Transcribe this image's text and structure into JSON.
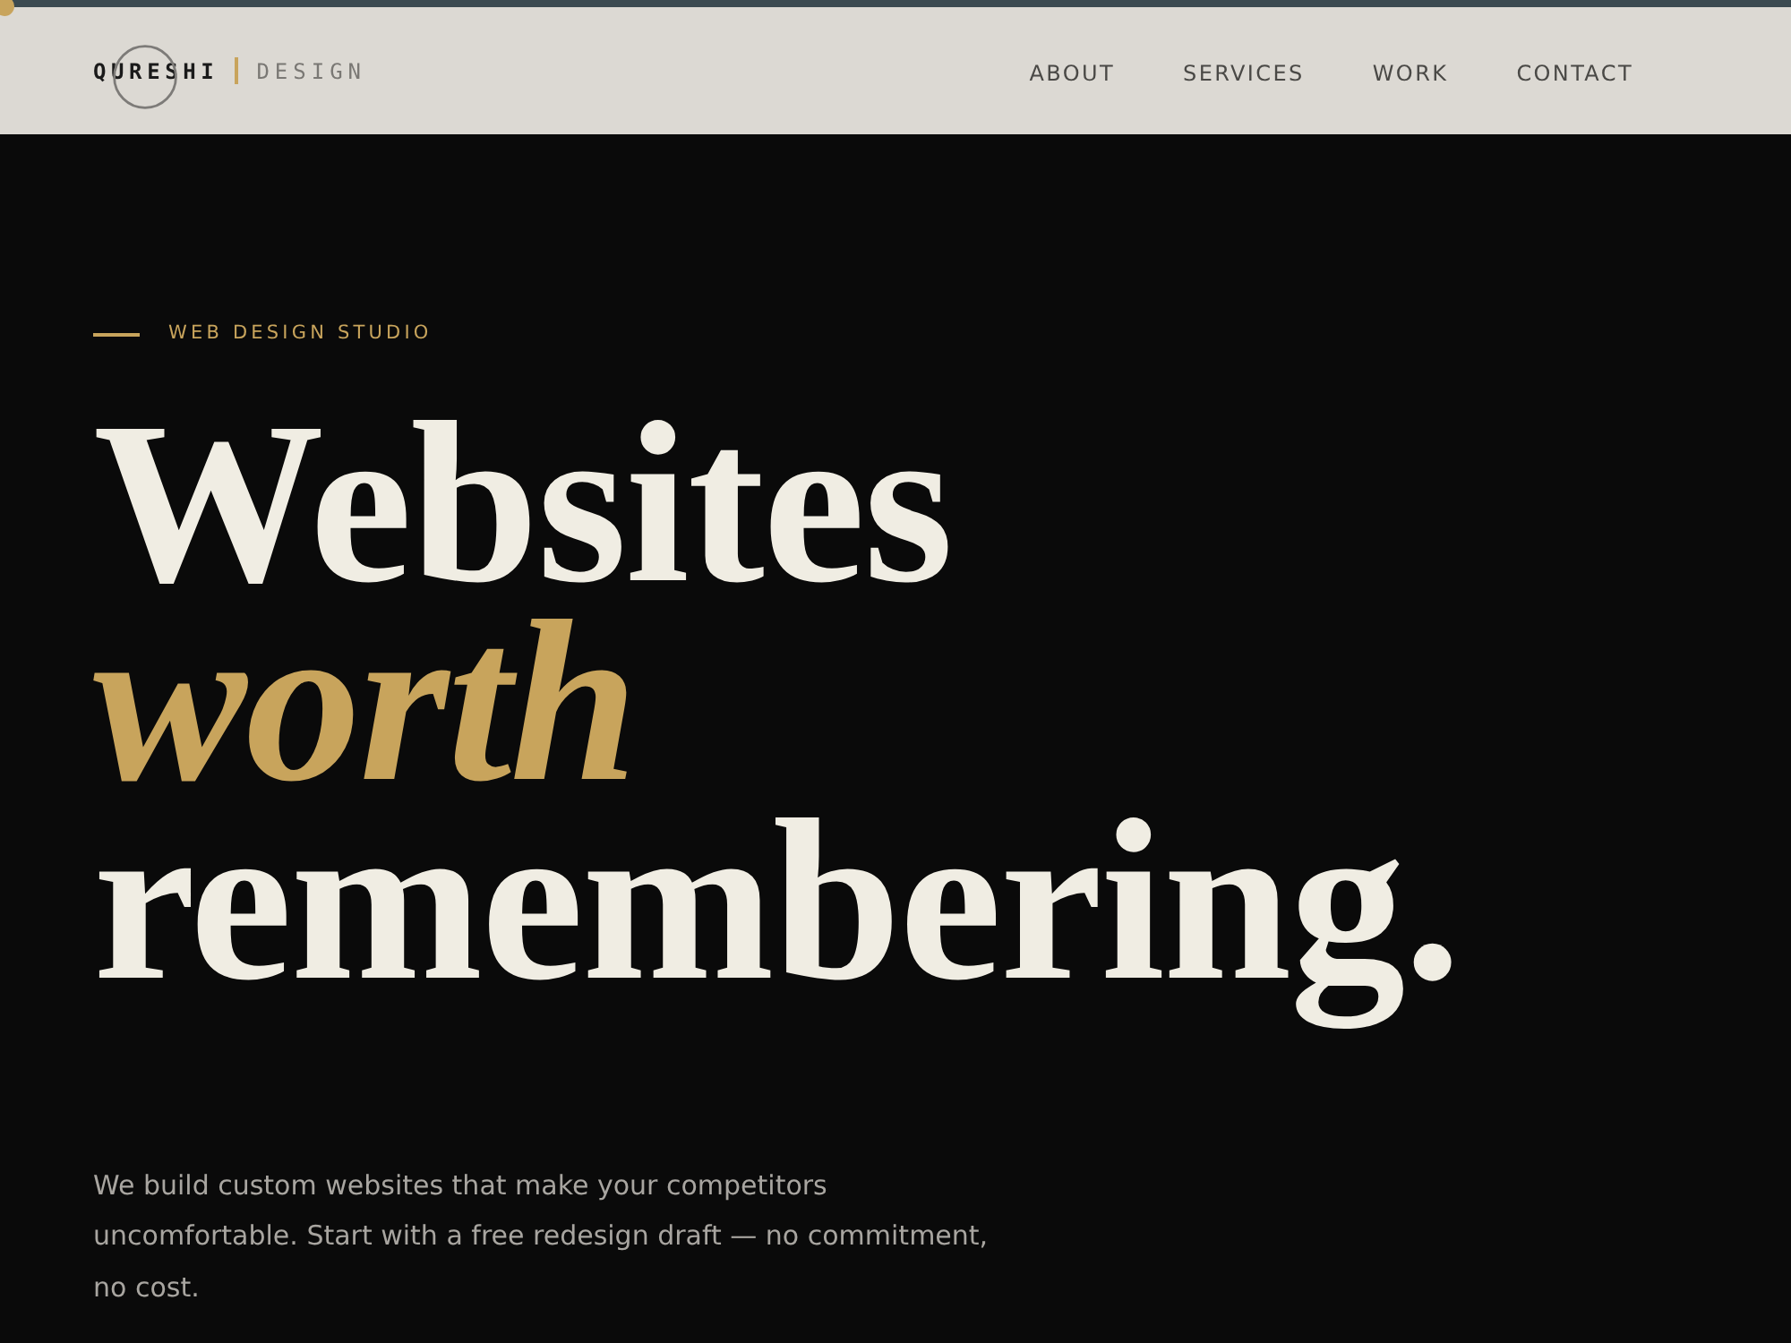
{
  "header": {
    "logo": {
      "name": "QURESHI",
      "suffix": "DESIGN"
    },
    "nav": [
      {
        "label": "ABOUT"
      },
      {
        "label": "SERVICES"
      },
      {
        "label": "WORK"
      },
      {
        "label": "CONTACT"
      }
    ]
  },
  "hero": {
    "eyebrow": "WEB DESIGN STUDIO",
    "headline": [
      {
        "text": "Websites",
        "kind": "plain"
      },
      {
        "text": "worth",
        "kind": "accent"
      },
      {
        "text": "remembering.",
        "kind": "plain"
      }
    ],
    "description": "We build custom websites that make your competitors uncomfortable. Start with a free redesign draft — no commitment, no cost."
  }
}
